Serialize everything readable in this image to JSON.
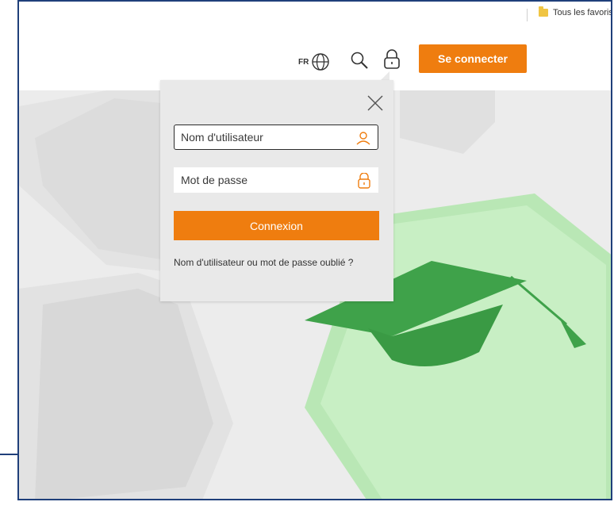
{
  "bookmarks": {
    "all_favorites_label": "Tous les favoris"
  },
  "header": {
    "language": "FR",
    "connect_label": "Se connecter"
  },
  "login_popup": {
    "username_placeholder": "Nom d'utilisateur",
    "password_placeholder": "Mot de passe",
    "submit_label": "Connexion",
    "forgot_label": "Nom d'utilisateur ou mot de passe oublié ?"
  },
  "colors": {
    "accent": "#ef7d0f",
    "frame_border": "#1f3f7a",
    "hero_key_green": "#b9e7b5"
  },
  "icons": [
    "folder-icon",
    "globe-icon",
    "search-icon",
    "lock-icon",
    "close-icon",
    "user-icon",
    "padlock-icon",
    "graduation-cap-icon"
  ]
}
